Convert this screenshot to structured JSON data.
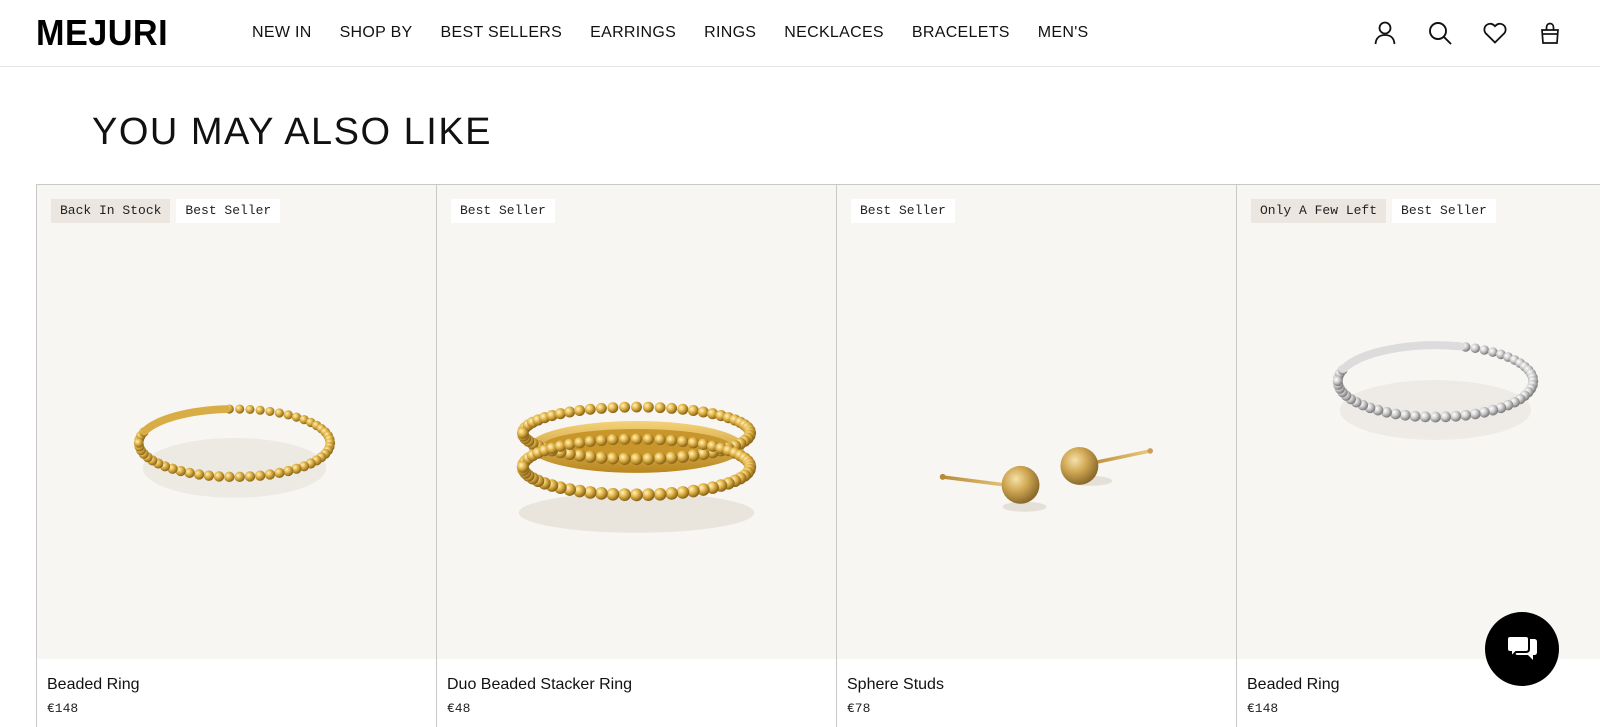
{
  "header": {
    "logo": "MEJURI",
    "nav": [
      {
        "label": "NEW IN"
      },
      {
        "label": "SHOP BY"
      },
      {
        "label": "BEST SELLERS"
      },
      {
        "label": "EARRINGS"
      },
      {
        "label": "RINGS"
      },
      {
        "label": "NECKLACES"
      },
      {
        "label": "BRACELETS"
      },
      {
        "label": "MEN'S"
      }
    ],
    "icons": [
      "account-icon",
      "search-icon",
      "wishlist-heart-icon",
      "cart-bag-icon"
    ]
  },
  "section": {
    "title": "YOU MAY ALSO LIKE"
  },
  "products": [
    {
      "name": "Beaded Ring",
      "price": "€148",
      "badges": [
        "Back In Stock",
        "Best Seller"
      ],
      "metal": "gold",
      "metal_color": "#d4a640"
    },
    {
      "name": "Duo Beaded Stacker Ring",
      "price": "€48",
      "badges": [
        "Best Seller"
      ],
      "metal": "gold",
      "metal_color": "#d4a640"
    },
    {
      "name": "Sphere Studs",
      "price": "€78",
      "badges": [
        "Best Seller"
      ],
      "metal": "gold",
      "metal_color": "#c9a860"
    },
    {
      "name": "Beaded Ring",
      "price": "€148",
      "badges": [
        "Only A Few Left",
        "Best Seller"
      ],
      "metal": "silver",
      "metal_color": "#c8c8c8"
    }
  ],
  "chat": {
    "icon": "chat-bubble-icon"
  },
  "colors": {
    "card_background": "#f8f6f2",
    "badge_background": "#ffffff",
    "badge_alt_background": "#ebe7e0",
    "text": "#111111"
  }
}
